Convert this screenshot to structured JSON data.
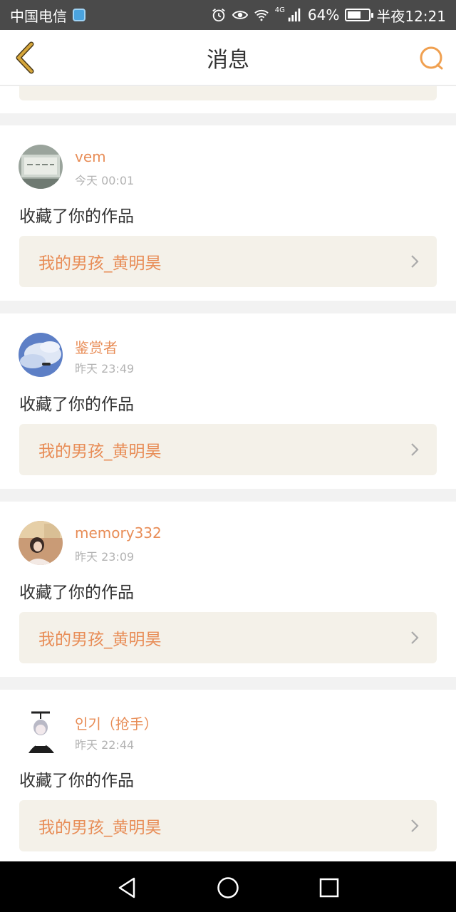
{
  "status_bar": {
    "carrier": "中国电信",
    "network": "4G",
    "battery": "64%",
    "battery_level": 0.64,
    "time": "半夜12:21",
    "icons": [
      "shield-icon",
      "alarm-icon",
      "eye-icon",
      "wifi-icon",
      "signal-icon",
      "battery-icon"
    ]
  },
  "nav": {
    "title": "消息",
    "back_icon": "chevron-left-icon",
    "search_icon": "search-icon"
  },
  "colors": {
    "accent": "#e88d57",
    "back_arrow": "#c99a2e",
    "work_box_bg": "#f4f1e9",
    "page_bg": "#f2f2f2",
    "status_bg": "#4a4a4a"
  },
  "messages": [
    {
      "username": "vem",
      "time": "今天 00:01",
      "action": "收藏了你的作品",
      "work_title": "我的男孩_黄明昊"
    },
    {
      "username": "鉴赏者",
      "time": "昨天 23:49",
      "action": "收藏了你的作品",
      "work_title": "我的男孩_黄明昊"
    },
    {
      "username": "memory332",
      "time": "昨天 23:09",
      "action": "收藏了你的作品",
      "work_title": "我的男孩_黄明昊"
    },
    {
      "username": "인기（抢手）",
      "time": "昨天 22:44",
      "action": "收藏了你的作品",
      "work_title": "我的男孩_黄明昊"
    }
  ],
  "system_nav": [
    "back-triangle-icon",
    "home-circle-icon",
    "recents-square-icon"
  ]
}
